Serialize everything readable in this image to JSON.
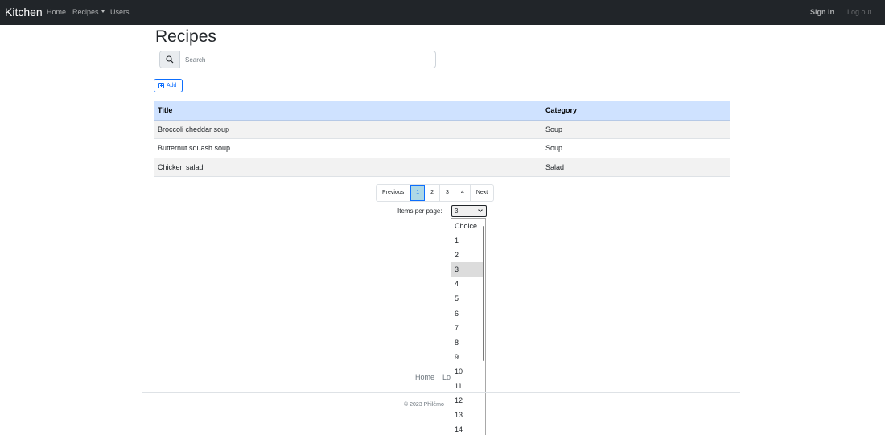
{
  "navbar": {
    "brand": "Kitchen",
    "links": [
      "Home",
      "Recipes",
      "Users"
    ],
    "sign_in": "Sign in",
    "log_out": "Log out"
  },
  "page_title": "Recipes",
  "search": {
    "placeholder": "Search",
    "value": "",
    "icon": "search-icon"
  },
  "add_button": {
    "label": "Add",
    "icon": "plus-square-icon"
  },
  "table": {
    "headers": [
      "Title",
      "Category"
    ],
    "rows": [
      [
        "Broccoli cheddar soup",
        "Soup"
      ],
      [
        "Butternut squash soup",
        "Soup"
      ],
      [
        "Chicken salad",
        "Salad"
      ]
    ],
    "header_color": "#cfe2ff"
  },
  "pagination": {
    "previous": "Previous",
    "pages": [
      "1",
      "2",
      "3",
      "4"
    ],
    "active_page": "1",
    "next": "Next"
  },
  "items_per_page": {
    "label": "Items per page:",
    "selected": "3",
    "options": [
      "Choice",
      "1",
      "2",
      "3",
      "4",
      "5",
      "6",
      "7",
      "8",
      "9",
      "10",
      "11",
      "12",
      "13",
      "14"
    ]
  },
  "footer": {
    "links": [
      "Home",
      "Lo"
    ],
    "copyright": "© 2023 Philémo"
  }
}
